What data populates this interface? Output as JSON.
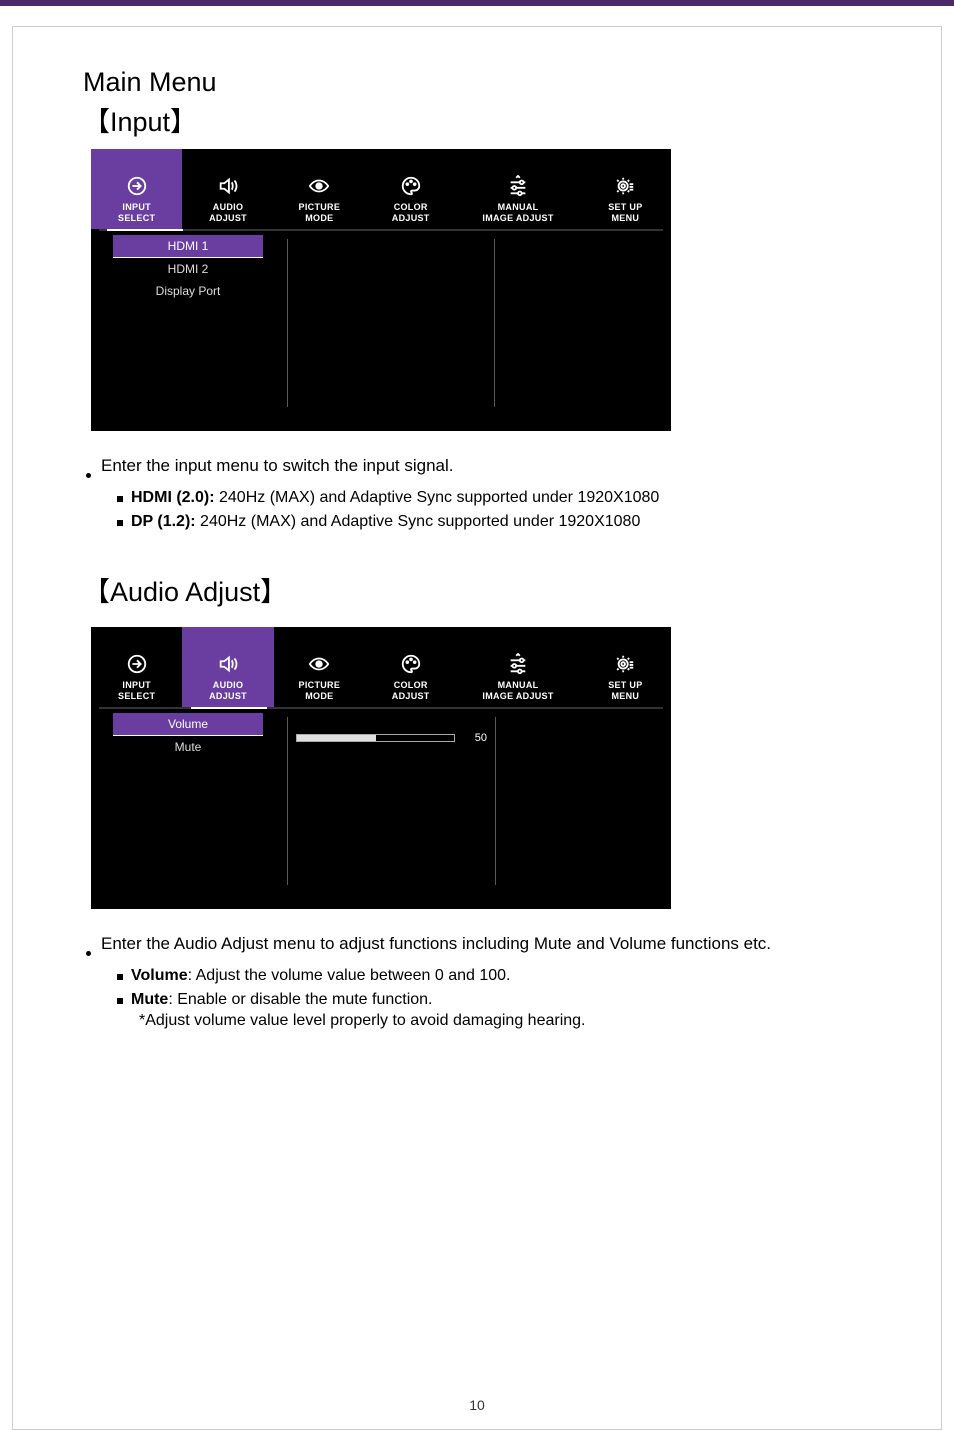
{
  "heading_main": "Main Menu",
  "heading_input": "【Input】",
  "heading_audio": "【Audio Adjust】",
  "tabs": {
    "input_select": "INPUT\nSELECT",
    "audio_adjust": "AUDIO\nADJUST",
    "picture_mode": "PICTURE\nMODE",
    "color_adjust": "COLOR\nADJUST",
    "manual_image_adjust": "MANUAL\nIMAGE ADJUST",
    "setup_menu": "SET UP\nMENU"
  },
  "osd1": {
    "active_tab": "input_select",
    "menu_items": [
      "HDMI 1",
      "HDMI 2",
      "Display Port"
    ],
    "selected_index": 0
  },
  "osd2": {
    "active_tab": "audio_adjust",
    "menu_items": [
      "Volume",
      "Mute"
    ],
    "selected_index": 0,
    "slider_value": "50",
    "slider_percent": 50
  },
  "notes_input": {
    "main": "Enter the input menu to switch the input signal.",
    "hdmi_label": "HDMI (2.0):",
    "hdmi_text": " 240Hz (MAX) and Adaptive Sync supported under 1920X1080",
    "dp_label": "DP (1.2):",
    "dp_text": " 240Hz (MAX) and Adaptive Sync supported under 1920X1080"
  },
  "notes_audio": {
    "main": "Enter the Audio Adjust menu to adjust functions including Mute and Volume functions etc.",
    "vol_label": "Volume",
    "vol_text": ": Adjust the volume value between 0 and 100.",
    "mute_label": "Mute",
    "mute_text": ": Enable or disable the mute function.",
    "star": "*Adjust volume value level properly to avoid damaging hearing."
  },
  "page_number": "10"
}
